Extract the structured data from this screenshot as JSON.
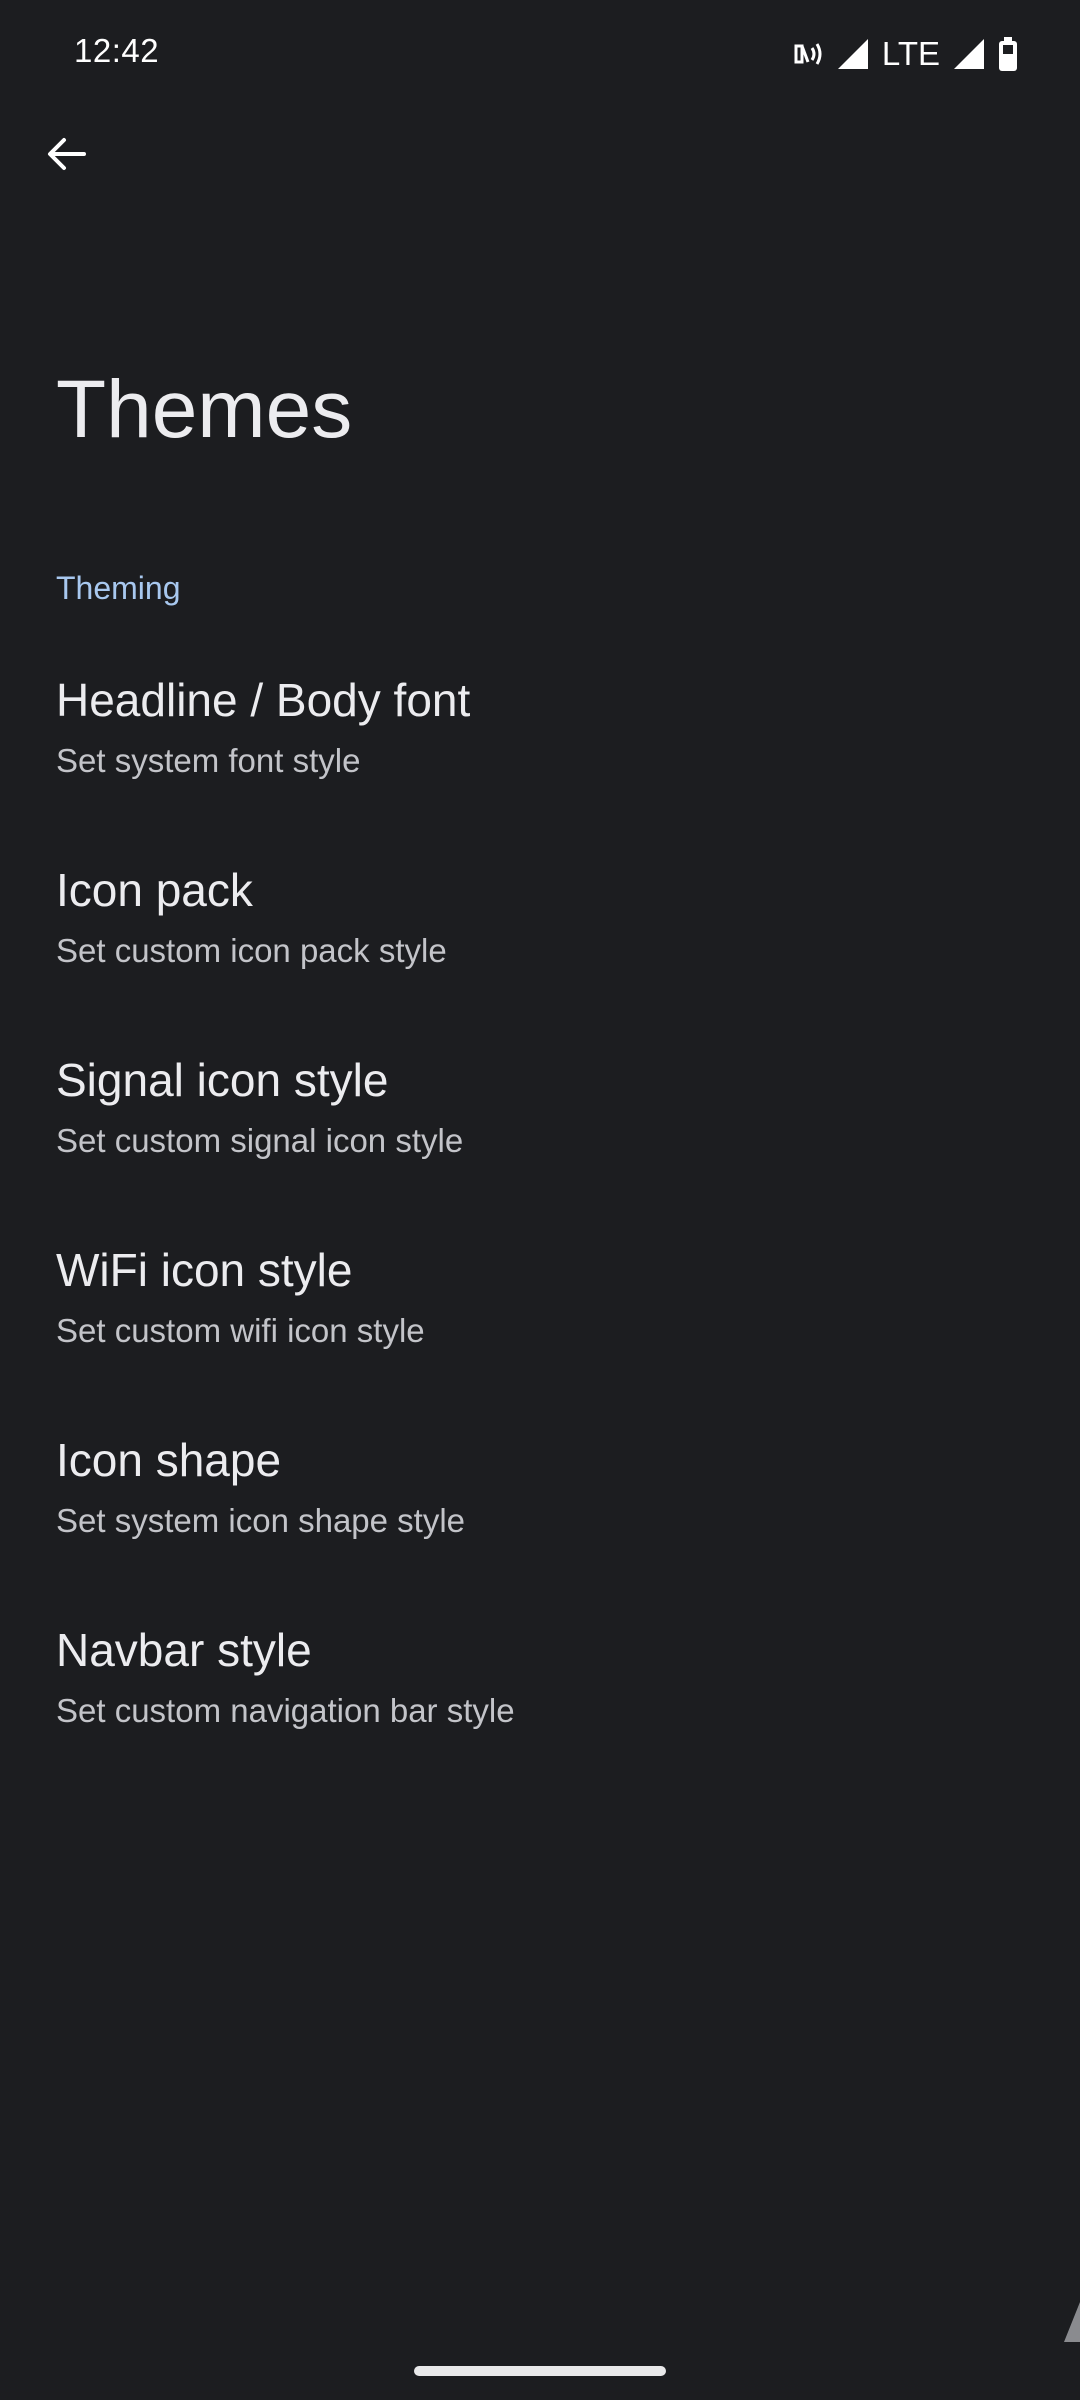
{
  "status_bar": {
    "time": "12:42",
    "network_label": "LTE",
    "icons": [
      "nfc-icon",
      "signal-icon",
      "signal-icon",
      "battery-icon"
    ]
  },
  "nav": {
    "back_icon": "arrow-back-icon"
  },
  "page": {
    "title": "Themes"
  },
  "section": {
    "header": "Theming",
    "items": [
      {
        "title": "Headline / Body font",
        "summary": "Set system font style"
      },
      {
        "title": "Icon pack",
        "summary": "Set custom icon pack style"
      },
      {
        "title": "Signal icon style",
        "summary": "Set custom signal icon style"
      },
      {
        "title": "WiFi icon style",
        "summary": "Set custom wifi icon style"
      },
      {
        "title": "Icon shape",
        "summary": "Set system icon shape style"
      },
      {
        "title": "Navbar style",
        "summary": "Set custom navigation bar style"
      }
    ]
  },
  "colors": {
    "background": "#1c1d20",
    "accent": "#a8c8ef",
    "text_primary": "#ececef",
    "text_secondary": "#c3c4c9"
  }
}
